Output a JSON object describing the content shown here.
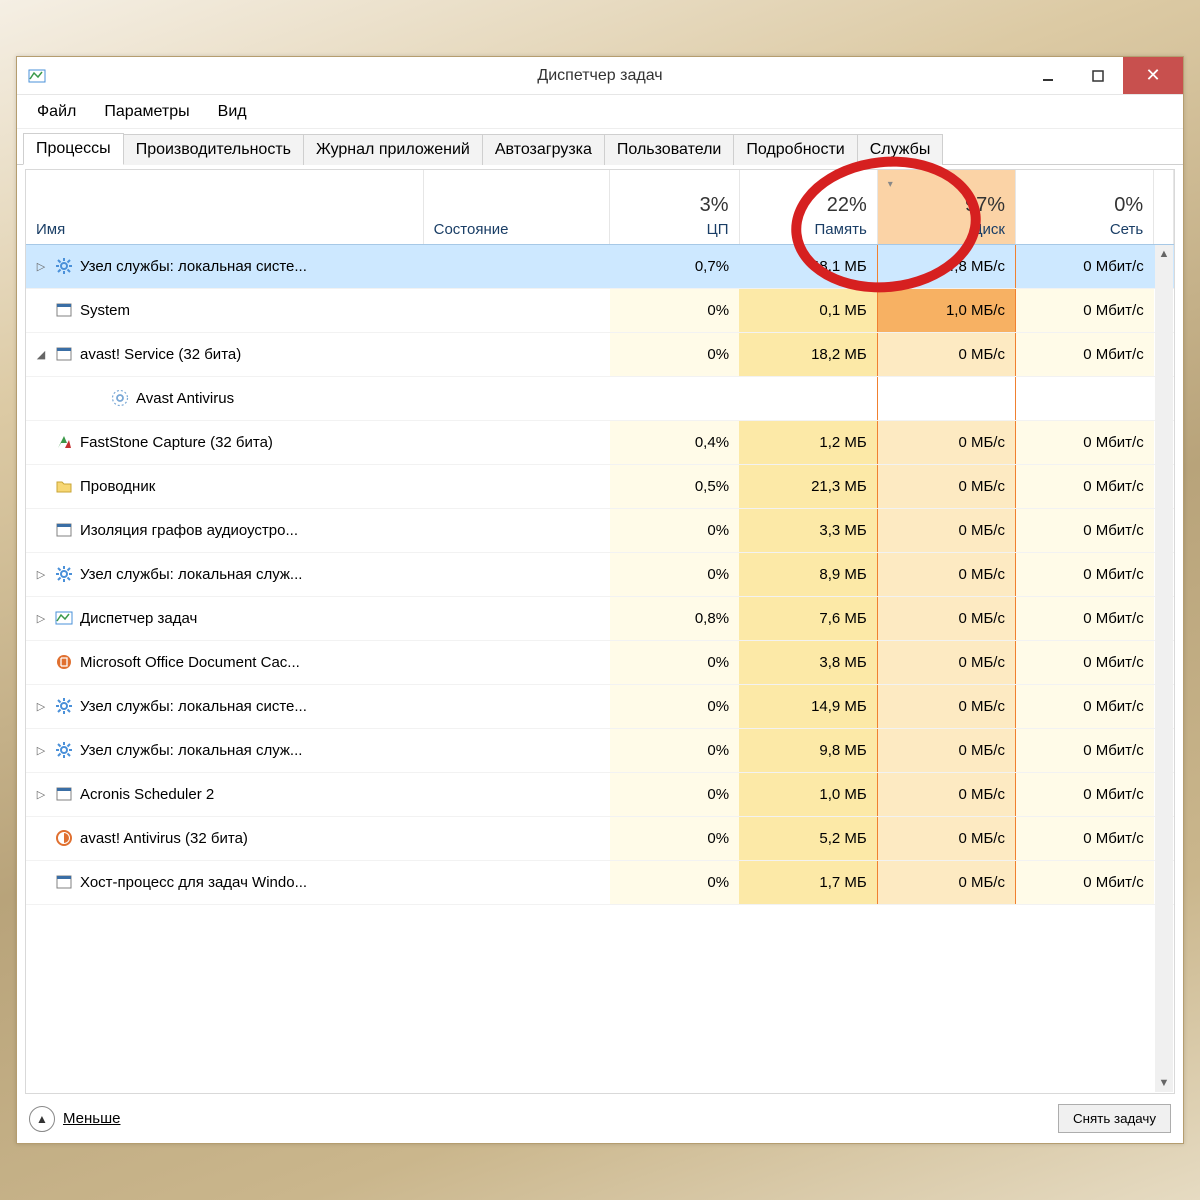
{
  "window": {
    "title": "Диспетчер задач"
  },
  "menu": {
    "file": "Файл",
    "options": "Параметры",
    "view": "Вид"
  },
  "tabs": {
    "processes": "Процессы",
    "performance": "Производительность",
    "apphistory": "Журнал приложений",
    "startup": "Автозагрузка",
    "users": "Пользователи",
    "details": "Подробности",
    "services": "Службы"
  },
  "headers": {
    "name": "Имя",
    "state": "Состояние",
    "cpu": {
      "pct": "3%",
      "label": "ЦП"
    },
    "mem": {
      "pct": "22%",
      "label": "Память"
    },
    "disk": {
      "pct": "97%",
      "label": "Диск"
    },
    "net": {
      "pct": "0%",
      "label": "Сеть"
    }
  },
  "rows": [
    {
      "exp": "▷",
      "icon": "gear",
      "name": "Узел службы: локальная систе...",
      "cpu": "0,7%",
      "mem": "48,1 МБ",
      "disk": "4,8 МБ/с",
      "net": "0 Мбит/с",
      "selected": true,
      "indent": 0
    },
    {
      "exp": "",
      "icon": "app",
      "name": "System",
      "cpu": "0%",
      "mem": "0,1 МБ",
      "disk": "1,0 МБ/с",
      "net": "0 Мбит/с",
      "diskHl": true,
      "indent": 0
    },
    {
      "exp": "◢",
      "icon": "app",
      "name": "avast! Service (32 бита)",
      "cpu": "0%",
      "mem": "18,2 МБ",
      "disk": "0 МБ/с",
      "net": "0 Мбит/с",
      "indent": 0
    },
    {
      "exp": "",
      "icon": "cog",
      "name": "Avast Antivirus",
      "cpu": "",
      "mem": "",
      "disk": "",
      "net": "",
      "child": true,
      "indent": 1
    },
    {
      "exp": "",
      "icon": "fs",
      "name": "FastStone Capture (32 бита)",
      "cpu": "0,4%",
      "mem": "1,2 МБ",
      "disk": "0 МБ/с",
      "net": "0 Мбит/с",
      "indent": 0
    },
    {
      "exp": "",
      "icon": "folder",
      "name": "Проводник",
      "cpu": "0,5%",
      "mem": "21,3 МБ",
      "disk": "0 МБ/с",
      "net": "0 Мбит/с",
      "indent": 0
    },
    {
      "exp": "",
      "icon": "app",
      "name": "Изоляция графов аудиоустро...",
      "cpu": "0%",
      "mem": "3,3 МБ",
      "disk": "0 МБ/с",
      "net": "0 Мбит/с",
      "indent": 0
    },
    {
      "exp": "▷",
      "icon": "gear",
      "name": "Узел службы: локальная служ...",
      "cpu": "0%",
      "mem": "8,9 МБ",
      "disk": "0 МБ/с",
      "net": "0 Мбит/с",
      "indent": 0
    },
    {
      "exp": "▷",
      "icon": "tm",
      "name": "Диспетчер задач",
      "cpu": "0,8%",
      "mem": "7,6 МБ",
      "disk": "0 МБ/с",
      "net": "0 Мбит/с",
      "indent": 0
    },
    {
      "exp": "",
      "icon": "office",
      "name": "Microsoft Office Document Cac...",
      "cpu": "0%",
      "mem": "3,8 МБ",
      "disk": "0 МБ/с",
      "net": "0 Мбит/с",
      "indent": 0
    },
    {
      "exp": "▷",
      "icon": "gear",
      "name": "Узел службы: локальная систе...",
      "cpu": "0%",
      "mem": "14,9 МБ",
      "disk": "0 МБ/с",
      "net": "0 Мбит/с",
      "indent": 0
    },
    {
      "exp": "▷",
      "icon": "gear",
      "name": "Узел службы: локальная служ...",
      "cpu": "0%",
      "mem": "9,8 МБ",
      "disk": "0 МБ/с",
      "net": "0 Мбит/с",
      "indent": 0
    },
    {
      "exp": "▷",
      "icon": "app",
      "name": "Acronis Scheduler 2",
      "cpu": "0%",
      "mem": "1,0 МБ",
      "disk": "0 МБ/с",
      "net": "0 Мбит/с",
      "indent": 0
    },
    {
      "exp": "",
      "icon": "avast",
      "name": "avast! Antivirus (32 бита)",
      "cpu": "0%",
      "mem": "5,2 МБ",
      "disk": "0 МБ/с",
      "net": "0 Мбит/с",
      "indent": 0
    },
    {
      "exp": "",
      "icon": "app",
      "name": "Хост-процесс для задач Windo...",
      "cpu": "0%",
      "mem": "1,7 МБ",
      "disk": "0 МБ/с",
      "net": "0 Мбит/с",
      "indent": 0
    }
  ],
  "footer": {
    "fewer": "Меньше",
    "endtask": "Снять задачу"
  }
}
